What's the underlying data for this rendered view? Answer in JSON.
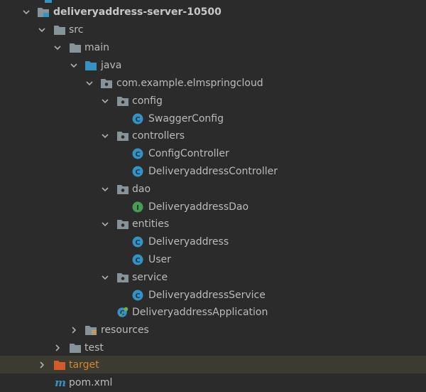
{
  "tree": {
    "root": {
      "label": "deliveryaddress-server-10500",
      "icon": "module-folder-icon",
      "expanded": true
    },
    "src": {
      "label": "src",
      "icon": "folder-icon",
      "expanded": true
    },
    "main": {
      "label": "main",
      "icon": "folder-icon",
      "expanded": true
    },
    "java": {
      "label": "java",
      "icon": "source-root-folder-icon",
      "expanded": true
    },
    "package": {
      "label": "com.example.elmspringcloud",
      "icon": "package-icon",
      "expanded": true
    },
    "config": {
      "label": "config",
      "icon": "package-icon",
      "expanded": true
    },
    "swagger_config": {
      "label": "SwaggerConfig",
      "icon": "class-icon",
      "badge": "C"
    },
    "controllers": {
      "label": "controllers",
      "icon": "package-icon",
      "expanded": true
    },
    "config_controller": {
      "label": "ConfigController",
      "icon": "class-icon",
      "badge": "C"
    },
    "deliveryaddress_controller": {
      "label": "DeliveryaddressController",
      "icon": "class-icon",
      "badge": "C"
    },
    "dao": {
      "label": "dao",
      "icon": "package-icon",
      "expanded": true
    },
    "deliveryaddress_dao": {
      "label": "DeliveryaddressDao",
      "icon": "interface-icon",
      "badge": "I"
    },
    "entities": {
      "label": "entities",
      "icon": "package-icon",
      "expanded": true
    },
    "deliveryaddress": {
      "label": "Deliveryaddress",
      "icon": "class-icon",
      "badge": "C"
    },
    "user": {
      "label": "User",
      "icon": "class-icon",
      "badge": "C"
    },
    "service": {
      "label": "service",
      "icon": "package-icon",
      "expanded": true
    },
    "deliveryaddress_service": {
      "label": "DeliveryaddressService",
      "icon": "class-icon",
      "badge": "C"
    },
    "application": {
      "label": "DeliveryaddressApplication",
      "icon": "spring-boot-class-icon",
      "badge": "C"
    },
    "resources": {
      "label": "resources",
      "icon": "resources-folder-icon",
      "expanded": false
    },
    "test": {
      "label": "test",
      "icon": "folder-icon",
      "expanded": false
    },
    "target": {
      "label": "target",
      "icon": "excluded-folder-icon",
      "expanded": false,
      "selected": true
    },
    "pom": {
      "label": "pom.xml",
      "icon": "maven-file-icon",
      "badge": "m"
    }
  },
  "colors": {
    "background": "#2b2b2b",
    "text": "#bbbbbb",
    "selected_row": "#3c3a31",
    "folder": "#87939a",
    "source_folder": "#3592c4",
    "excluded_folder": "#d35b2b",
    "class_badge": "#3592c4",
    "interface_badge": "#499c54",
    "target_text": "#d08a2b"
  }
}
